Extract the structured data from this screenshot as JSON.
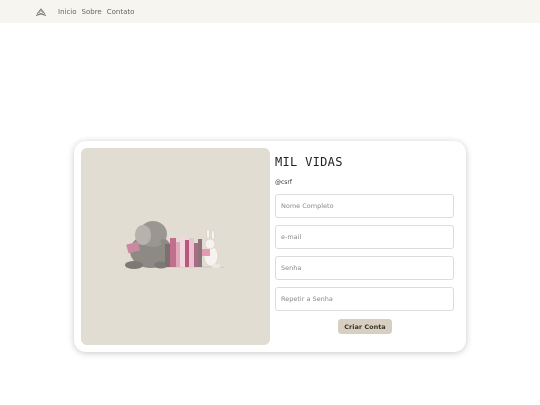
{
  "nav": {
    "logo_icon": "book-logo-icon",
    "links": [
      "Inicio",
      "Sobre",
      "Contato"
    ]
  },
  "form": {
    "title": "MIL VIDAS",
    "csrf": "@csrf",
    "fields": {
      "name_placeholder": "Nome Completo",
      "email_placeholder": "e-mail",
      "password_placeholder": "Senha",
      "confirm_placeholder": "Repetir a Senha"
    },
    "submit_label": "Criar Conta"
  },
  "illustration": "elephant-and-bunny-reading-with-books"
}
